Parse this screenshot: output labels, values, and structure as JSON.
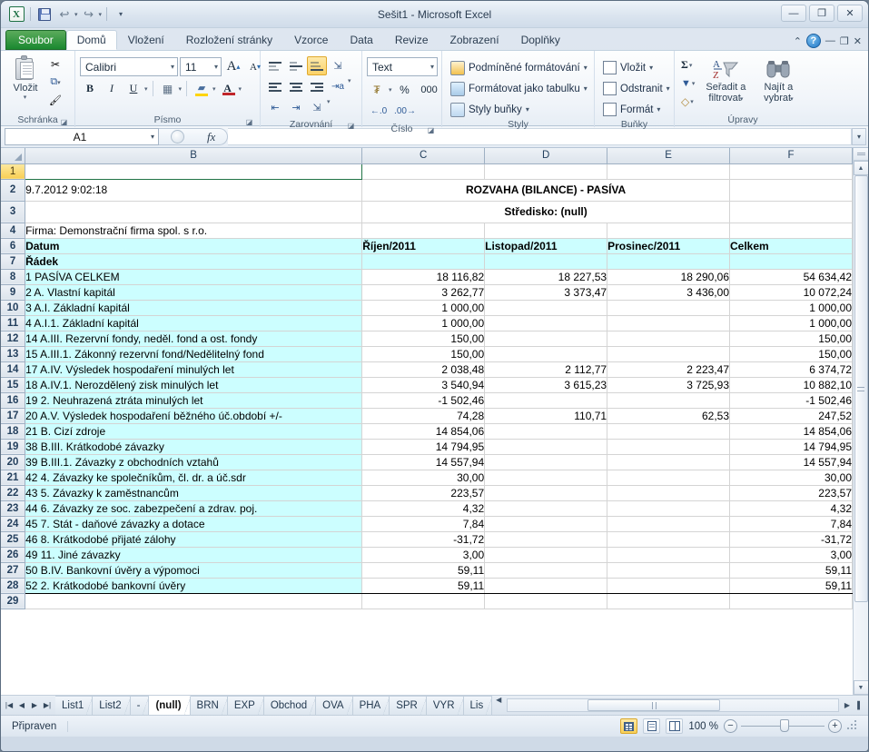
{
  "window": {
    "title": "Sešit1  -  Microsoft Excel",
    "minimize": "—",
    "restore": "❐",
    "close": "✕"
  },
  "quick_access": {
    "app_logo": "X",
    "save": "save-icon",
    "undo": "↩",
    "redo": "↪",
    "customize": "▾"
  },
  "ribbon_tabs": [
    {
      "label": "Soubor",
      "type": "file"
    },
    {
      "label": "Domů",
      "type": "active"
    },
    {
      "label": "Vložení",
      "type": "normal"
    },
    {
      "label": "Rozložení stránky",
      "type": "normal"
    },
    {
      "label": "Vzorce",
      "type": "normal"
    },
    {
      "label": "Data",
      "type": "normal"
    },
    {
      "label": "Revize",
      "type": "normal"
    },
    {
      "label": "Zobrazení",
      "type": "normal"
    },
    {
      "label": "Doplňky",
      "type": "normal"
    }
  ],
  "ribbon_right": {
    "collapse": "⌃",
    "help": "?",
    "minimize": "—",
    "restore": "❐",
    "close": "✕"
  },
  "ribbon": {
    "clipboard": {
      "label": "Schránka",
      "paste": "Vložit",
      "paste_caret": "▾",
      "cut": "✂",
      "copy": "⧉",
      "format_painter": "🖌"
    },
    "font": {
      "label": "Písmo",
      "font_name": "Calibri",
      "font_size": "11",
      "grow": "A",
      "shrink": "A",
      "bold": "B",
      "italic": "I",
      "underline": "U",
      "borders": "▦",
      "fill": "A",
      "color": "A"
    },
    "alignment": {
      "label": "Zarovnání",
      "top": "top-align",
      "middle": "middle-align",
      "bottom": "bottom-align",
      "orientation": "text-orientation",
      "align_left": "align-left",
      "align_center": "align-center",
      "align_right": "align-right",
      "wrap": "wrap-text",
      "indent_dec": "decrease-indent",
      "indent_inc": "increase-indent",
      "merge": "merge-center"
    },
    "number": {
      "label": "Číslo",
      "format": "Text",
      "accounting": "currency",
      "percent": "%",
      "comma": "000",
      "inc_dec": ".00",
      "dec_dec": ".0"
    },
    "styles": {
      "label": "Styly",
      "conditional": "Podmíněné formátování",
      "as_table": "Formátovat jako tabulku",
      "cell_styles": "Styly buňky",
      "caret": "▾"
    },
    "cells": {
      "label": "Buňky",
      "insert": "Vložit",
      "delete": "Odstranit",
      "format": "Formát",
      "caret": "▾"
    },
    "editing": {
      "label": "Úpravy",
      "autosum": "Σ",
      "fill": "▼",
      "clear": "◇",
      "sort_line1": "Seřadit a",
      "sort_line2": "filtrovat",
      "find_line1": "Najít a",
      "find_line2": "vybrat",
      "caret": "▾"
    }
  },
  "formula_bar": {
    "name_box": "A1",
    "name_box_caret": "▾",
    "fx": "fx",
    "formula_value": "",
    "expand": "▾"
  },
  "grid": {
    "columns": [
      "B",
      "C",
      "D",
      "E",
      "F"
    ],
    "rows": [
      {
        "num": "1",
        "selected": true,
        "cells": [
          {
            "v": "",
            "cls": "selcell"
          },
          {
            "v": "",
            "cls": ""
          },
          {
            "v": "",
            "cls": ""
          },
          {
            "v": "",
            "cls": ""
          },
          {
            "v": "",
            "cls": ""
          }
        ]
      },
      {
        "num": "2",
        "tall": true,
        "cells": [
          {
            "v": "9.7.2012 9:02:18",
            "cls": ""
          },
          {
            "v": "ROZVAHA (BILANCE) - PASÍVA",
            "cls": "title span"
          },
          {
            "v": "",
            "cls": "hidden"
          },
          {
            "v": "",
            "cls": "hidden"
          },
          {
            "v": "",
            "cls": ""
          }
        ]
      },
      {
        "num": "3",
        "tall": true,
        "cells": [
          {
            "v": "",
            "cls": ""
          },
          {
            "v": "Středisko: (null)",
            "cls": "sub span"
          },
          {
            "v": "",
            "cls": "hidden"
          },
          {
            "v": "",
            "cls": "hidden"
          },
          {
            "v": "",
            "cls": ""
          }
        ]
      },
      {
        "num": "4",
        "cells": [
          {
            "v": "Firma: Demonstrační firma spol. s r.o.",
            "cls": ""
          },
          {
            "v": "",
            "cls": ""
          },
          {
            "v": "",
            "cls": ""
          },
          {
            "v": "",
            "cls": ""
          },
          {
            "v": "",
            "cls": ""
          }
        ]
      },
      {
        "num": "6",
        "cells": [
          {
            "v": "Datum",
            "cls": "cyan bd"
          },
          {
            "v": "Říjen/2011",
            "cls": "cyan bd bl"
          },
          {
            "v": "Listopad/2011",
            "cls": "cyan bd bl"
          },
          {
            "v": "Prosinec/2011",
            "cls": "cyan bd bl"
          },
          {
            "v": "Celkem",
            "cls": "cyan bd bl"
          }
        ]
      },
      {
        "num": "7",
        "cells": [
          {
            "v": "Řádek",
            "cls": "cyan bd"
          },
          {
            "v": "",
            "cls": "cyan bl"
          },
          {
            "v": "",
            "cls": "cyan bl"
          },
          {
            "v": "",
            "cls": "cyan bl"
          },
          {
            "v": "",
            "cls": "cyan bl"
          }
        ]
      },
      {
        "num": "8",
        "cells": [
          {
            "v": "1          PASÍVA CELKEM",
            "cls": "cyan bt"
          },
          {
            "v": "18 116,82",
            "cls": "num bt bl"
          },
          {
            "v": "18 227,53",
            "cls": "num bt bl"
          },
          {
            "v": "18 290,06",
            "cls": "num bt bl"
          },
          {
            "v": "54 634,42",
            "cls": "num bt bl"
          }
        ]
      },
      {
        "num": "9",
        "cells": [
          {
            "v": "2 A.       Vlastní kapitál",
            "cls": "cyan bt"
          },
          {
            "v": "3 262,77",
            "cls": "num bt bl"
          },
          {
            "v": "3 373,47",
            "cls": "num bt bl"
          },
          {
            "v": "3 436,00",
            "cls": "num bt bl"
          },
          {
            "v": "10 072,24",
            "cls": "num bt bl"
          }
        ]
      },
      {
        "num": "10",
        "cells": [
          {
            "v": "3 A.I.     Základní kapitál",
            "cls": "cyan bt"
          },
          {
            "v": "1 000,00",
            "cls": "num bt bl"
          },
          {
            "v": "",
            "cls": "num bt bl"
          },
          {
            "v": "",
            "cls": "num bt bl"
          },
          {
            "v": "1 000,00",
            "cls": "num bt bl"
          }
        ]
      },
      {
        "num": "11",
        "cells": [
          {
            "v": "4 A.I.1.   Základní kapitál",
            "cls": "cyan bt"
          },
          {
            "v": "1 000,00",
            "cls": "num bt bl"
          },
          {
            "v": "",
            "cls": "num bt bl"
          },
          {
            "v": "",
            "cls": "num bt bl"
          },
          {
            "v": "1 000,00",
            "cls": "num bt bl"
          }
        ]
      },
      {
        "num": "12",
        "cells": [
          {
            "v": "14 A.III.   Rezervní fondy, neděl. fond a ost. fondy",
            "cls": "cyan bt"
          },
          {
            "v": "150,00",
            "cls": "num bt bl"
          },
          {
            "v": "",
            "cls": "num bt bl"
          },
          {
            "v": "",
            "cls": "num bt bl"
          },
          {
            "v": "150,00",
            "cls": "num bt bl"
          }
        ]
      },
      {
        "num": "13",
        "cells": [
          {
            "v": "15 A.III.1. Zákonný rezervní fond/Nedělitelný fond",
            "cls": "cyan bt"
          },
          {
            "v": "150,00",
            "cls": "num bt bl"
          },
          {
            "v": "",
            "cls": "num bt bl"
          },
          {
            "v": "",
            "cls": "num bt bl"
          },
          {
            "v": "150,00",
            "cls": "num bt bl"
          }
        ]
      },
      {
        "num": "14",
        "cells": [
          {
            "v": "17 A.IV.   Výsledek hospodaření minulých let",
            "cls": "cyan bt"
          },
          {
            "v": "2 038,48",
            "cls": "num bt bl"
          },
          {
            "v": "2 112,77",
            "cls": "num bt bl"
          },
          {
            "v": "2 223,47",
            "cls": "num bt bl"
          },
          {
            "v": "6 374,72",
            "cls": "num bt bl"
          }
        ]
      },
      {
        "num": "15",
        "cells": [
          {
            "v": "18 A.IV.1. Nerozdělený zisk minulých let",
            "cls": "cyan bt"
          },
          {
            "v": "3 540,94",
            "cls": "num bt bl"
          },
          {
            "v": "3 615,23",
            "cls": "num bt bl"
          },
          {
            "v": "3 725,93",
            "cls": "num bt bl"
          },
          {
            "v": "10 882,10",
            "cls": "num bt bl"
          }
        ]
      },
      {
        "num": "16",
        "cells": [
          {
            "v": "19      2.  Neuhrazená ztráta minulých let",
            "cls": "cyan bt"
          },
          {
            "v": "-1 502,46",
            "cls": "num bt bl"
          },
          {
            "v": "",
            "cls": "num bt bl"
          },
          {
            "v": "",
            "cls": "num bt bl"
          },
          {
            "v": "-1 502,46",
            "cls": "num bt bl"
          }
        ]
      },
      {
        "num": "17",
        "cells": [
          {
            "v": "20 A.V.    Výsledek hospodaření běžného úč.období +/-",
            "cls": "cyan bt"
          },
          {
            "v": "74,28",
            "cls": "num bt bl"
          },
          {
            "v": "110,71",
            "cls": "num bt bl"
          },
          {
            "v": "62,53",
            "cls": "num bt bl"
          },
          {
            "v": "247,52",
            "cls": "num bt bl"
          }
        ]
      },
      {
        "num": "18",
        "cells": [
          {
            "v": "21 B.       Cizí zdroje",
            "cls": "cyan bt"
          },
          {
            "v": "14 854,06",
            "cls": "num bt bl"
          },
          {
            "v": "",
            "cls": "num bt bl"
          },
          {
            "v": "",
            "cls": "num bt bl"
          },
          {
            "v": "14 854,06",
            "cls": "num bt bl"
          }
        ]
      },
      {
        "num": "19",
        "cells": [
          {
            "v": "38 B.III.   Krátkodobé závazky",
            "cls": "cyan bt"
          },
          {
            "v": "14 794,95",
            "cls": "num bt bl"
          },
          {
            "v": "",
            "cls": "num bt bl"
          },
          {
            "v": "",
            "cls": "num bt bl"
          },
          {
            "v": "14 794,95",
            "cls": "num bt bl"
          }
        ]
      },
      {
        "num": "20",
        "cells": [
          {
            "v": "39 B.III.1.  Závazky z obchodních vztahů",
            "cls": "cyan bt"
          },
          {
            "v": "14 557,94",
            "cls": "num bt bl"
          },
          {
            "v": "",
            "cls": "num bt bl"
          },
          {
            "v": "",
            "cls": "num bt bl"
          },
          {
            "v": "14 557,94",
            "cls": "num bt bl"
          }
        ]
      },
      {
        "num": "21",
        "cells": [
          {
            "v": "42      4.  Závazky ke společníkům, čl. dr. a úč.sdr",
            "cls": "cyan bt"
          },
          {
            "v": "30,00",
            "cls": "num bt bl"
          },
          {
            "v": "",
            "cls": "num bt bl"
          },
          {
            "v": "",
            "cls": "num bt bl"
          },
          {
            "v": "30,00",
            "cls": "num bt bl"
          }
        ]
      },
      {
        "num": "22",
        "cells": [
          {
            "v": "43      5.  Závazky k zaměstnancům",
            "cls": "cyan bt"
          },
          {
            "v": "223,57",
            "cls": "num bt bl"
          },
          {
            "v": "",
            "cls": "num bt bl"
          },
          {
            "v": "",
            "cls": "num bt bl"
          },
          {
            "v": "223,57",
            "cls": "num bt bl"
          }
        ]
      },
      {
        "num": "23",
        "cells": [
          {
            "v": "44      6.  Závazky ze soc. zabezpečení a zdrav. poj.",
            "cls": "cyan bt"
          },
          {
            "v": "4,32",
            "cls": "num bt bl"
          },
          {
            "v": "",
            "cls": "num bt bl"
          },
          {
            "v": "",
            "cls": "num bt bl"
          },
          {
            "v": "4,32",
            "cls": "num bt bl"
          }
        ]
      },
      {
        "num": "24",
        "cells": [
          {
            "v": "45      7.  Stát - daňové závazky a dotace",
            "cls": "cyan bt"
          },
          {
            "v": "7,84",
            "cls": "num bt bl"
          },
          {
            "v": "",
            "cls": "num bt bl"
          },
          {
            "v": "",
            "cls": "num bt bl"
          },
          {
            "v": "7,84",
            "cls": "num bt bl"
          }
        ]
      },
      {
        "num": "25",
        "cells": [
          {
            "v": "46      8.  Krátkodobé přijaté zálohy",
            "cls": "cyan bt"
          },
          {
            "v": "-31,72",
            "cls": "num bt bl"
          },
          {
            "v": "",
            "cls": "num bt bl"
          },
          {
            "v": "",
            "cls": "num bt bl"
          },
          {
            "v": "-31,72",
            "cls": "num bt bl"
          }
        ]
      },
      {
        "num": "26",
        "cells": [
          {
            "v": "49     11.  Jiné závazky",
            "cls": "cyan bt"
          },
          {
            "v": "3,00",
            "cls": "num bt bl"
          },
          {
            "v": "",
            "cls": "num bt bl"
          },
          {
            "v": "",
            "cls": "num bt bl"
          },
          {
            "v": "3,00",
            "cls": "num bt bl"
          }
        ]
      },
      {
        "num": "27",
        "cells": [
          {
            "v": "50 B.IV.    Bankovní úvěry a výpomoci",
            "cls": "cyan bt"
          },
          {
            "v": "59,11",
            "cls": "num bt bl"
          },
          {
            "v": "",
            "cls": "num bt bl"
          },
          {
            "v": "",
            "cls": "num bt bl"
          },
          {
            "v": "59,11",
            "cls": "num bt bl"
          }
        ]
      },
      {
        "num": "28",
        "cells": [
          {
            "v": "52      2.  Krátkodobé bankovní úvěry",
            "cls": "cyan bt bb"
          },
          {
            "v": "59,11",
            "cls": "num bt bb bl"
          },
          {
            "v": "",
            "cls": "num bt bb bl"
          },
          {
            "v": "",
            "cls": "num bt bb bl"
          },
          {
            "v": "59,11",
            "cls": "num bt bb bl"
          }
        ]
      },
      {
        "num": "29",
        "partial": true,
        "cells": [
          {
            "v": "",
            "cls": ""
          },
          {
            "v": "",
            "cls": ""
          },
          {
            "v": "",
            "cls": ""
          },
          {
            "v": "",
            "cls": ""
          },
          {
            "v": "",
            "cls": ""
          }
        ]
      }
    ]
  },
  "sheet_tabs": {
    "nav": {
      "first": "|◀",
      "prev": "◀",
      "next": "▶",
      "last": "▶|"
    },
    "tabs": [
      {
        "label": "List1",
        "active": false
      },
      {
        "label": "List2",
        "active": false
      },
      {
        "label": "-",
        "active": false
      },
      {
        "label": "(null)",
        "active": true
      },
      {
        "label": "BRN",
        "active": false
      },
      {
        "label": "EXP",
        "active": false
      },
      {
        "label": "Obchod",
        "active": false
      },
      {
        "label": "OVA",
        "active": false
      },
      {
        "label": "PHA",
        "active": false
      },
      {
        "label": "SPR",
        "active": false
      },
      {
        "label": "VYR",
        "active": false
      },
      {
        "label": "Lis",
        "active": false
      }
    ]
  },
  "status_bar": {
    "state": "Připraven",
    "view_normal": "normal-view",
    "view_layout": "page-layout-view",
    "view_break": "page-break-view",
    "zoom": "100 %",
    "zoom_out": "−",
    "zoom_in": "+"
  }
}
